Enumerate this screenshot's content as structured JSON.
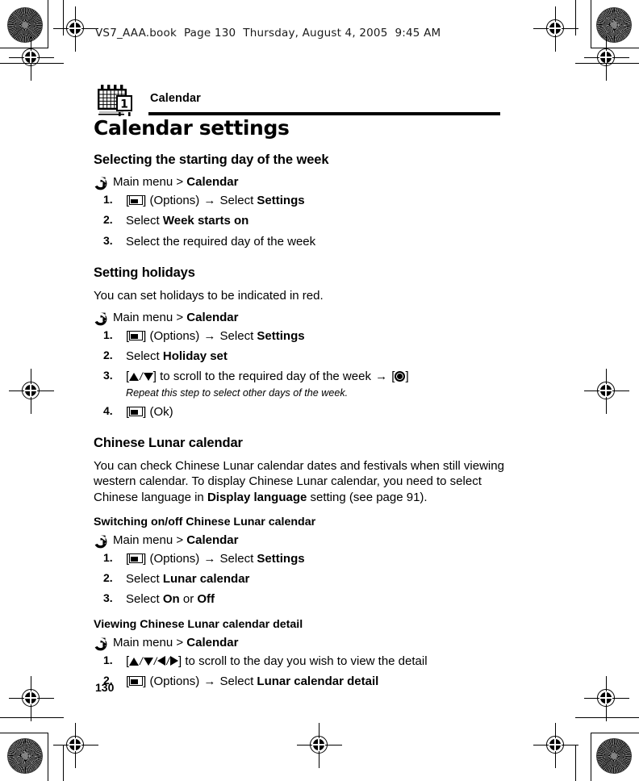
{
  "running_head": "VS7_AAA.book  Page 130  Thursday, August 4, 2005  9:45 AM",
  "chapter": {
    "icon": "calendar-icon",
    "label": "Calendar"
  },
  "title": "Calendar settings",
  "folio": "130",
  "glyphs": {
    "path_bullet": "circled-right-arrow",
    "softkey": "left-softkey-icon",
    "select": "center-select-key-icon",
    "up": "up-arrow-key",
    "down": "down-arrow-key",
    "left": "left-arrow-key",
    "right": "right-arrow-key",
    "then": "→",
    "separator": "/",
    "bracket_open": "[",
    "bracket_close": "]"
  },
  "sections": [
    {
      "heading": "Selecting the starting day of the week",
      "path_prefix": "Main menu > ",
      "path_target": "Calendar",
      "steps": [
        {
          "num": "1.",
          "pre": " (Options) ",
          "mid": " Select ",
          "bold": "Settings",
          "post": ""
        },
        {
          "num": "2.",
          "plain_pre": "Select ",
          "bold": "Week starts on",
          "post": ""
        },
        {
          "num": "3.",
          "plain_pre": "Select the required day of the week",
          "bold": "",
          "post": ""
        }
      ]
    },
    {
      "heading": "Setting holidays",
      "intro": "You can set holidays to be indicated in red.",
      "path_prefix": "Main menu > ",
      "path_target": "Calendar",
      "steps": [
        {
          "num": "1.",
          "pre": " (Options) ",
          "mid": " Select ",
          "bold": "Settings",
          "post": ""
        },
        {
          "num": "2.",
          "plain_pre": "Select ",
          "bold": "Holiday set",
          "post": ""
        },
        {
          "num": "3.",
          "scroll_text": " to scroll to the required day of the week ",
          "note": "Repeat this step to select other days of the week."
        },
        {
          "num": "4.",
          "pre": " (Ok)",
          "mid": "",
          "bold": "",
          "post": ""
        }
      ]
    },
    {
      "heading": "Chinese Lunar calendar",
      "body_pre": "You can check Chinese Lunar calendar dates and festivals when still viewing western calendar. To display Chinese Lunar calendar, you need to select Chinese language in ",
      "body_bold": "Display language",
      "body_post": " setting (see page 91).",
      "subsections": [
        {
          "heading": "Switching on/off Chinese Lunar calendar",
          "path_prefix": "Main menu > ",
          "path_target": "Calendar",
          "steps": [
            {
              "num": "1.",
              "pre": " (Options) ",
              "mid": " Select ",
              "bold": "Settings",
              "post": ""
            },
            {
              "num": "2.",
              "plain_pre": "Select ",
              "bold": "Lunar calendar",
              "post": ""
            },
            {
              "num": "3.",
              "plain_pre": "Select ",
              "bold": "On",
              "mid_plain": " or ",
              "bold2": "Off"
            }
          ]
        },
        {
          "heading": "Viewing Chinese Lunar calendar detail",
          "path_prefix": "Main menu > ",
          "path_target": "Calendar",
          "steps": [
            {
              "num": "1.",
              "scroll4_text": " to scroll to the day you wish to view the detail"
            },
            {
              "num": "2.",
              "pre": " (Options) ",
              "mid": " Select ",
              "bold": "Lunar calendar detail",
              "post": ""
            }
          ]
        }
      ]
    }
  ]
}
